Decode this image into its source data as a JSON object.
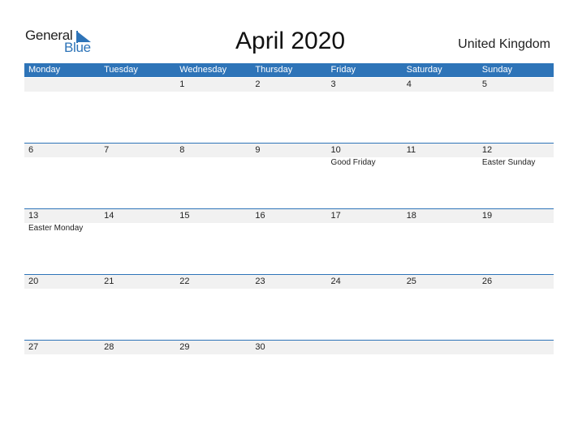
{
  "brand": {
    "line1": "General",
    "line2": "Blue",
    "accent": "#2e74b8"
  },
  "title": "April 2020",
  "country": "United Kingdom",
  "weekdays": [
    "Monday",
    "Tuesday",
    "Wednesday",
    "Thursday",
    "Friday",
    "Saturday",
    "Sunday"
  ],
  "weeks": [
    [
      {
        "d": ""
      },
      {
        "d": ""
      },
      {
        "d": "1"
      },
      {
        "d": "2"
      },
      {
        "d": "3"
      },
      {
        "d": "4"
      },
      {
        "d": "5"
      }
    ],
    [
      {
        "d": "6"
      },
      {
        "d": "7"
      },
      {
        "d": "8"
      },
      {
        "d": "9"
      },
      {
        "d": "10",
        "e": "Good Friday"
      },
      {
        "d": "11"
      },
      {
        "d": "12",
        "e": "Easter Sunday"
      }
    ],
    [
      {
        "d": "13",
        "e": "Easter Monday"
      },
      {
        "d": "14"
      },
      {
        "d": "15"
      },
      {
        "d": "16"
      },
      {
        "d": "17"
      },
      {
        "d": "18"
      },
      {
        "d": "19"
      }
    ],
    [
      {
        "d": "20"
      },
      {
        "d": "21"
      },
      {
        "d": "22"
      },
      {
        "d": "23"
      },
      {
        "d": "24"
      },
      {
        "d": "25"
      },
      {
        "d": "26"
      }
    ],
    [
      {
        "d": "27"
      },
      {
        "d": "28"
      },
      {
        "d": "29"
      },
      {
        "d": "30"
      },
      {
        "d": ""
      },
      {
        "d": ""
      },
      {
        "d": ""
      }
    ]
  ]
}
